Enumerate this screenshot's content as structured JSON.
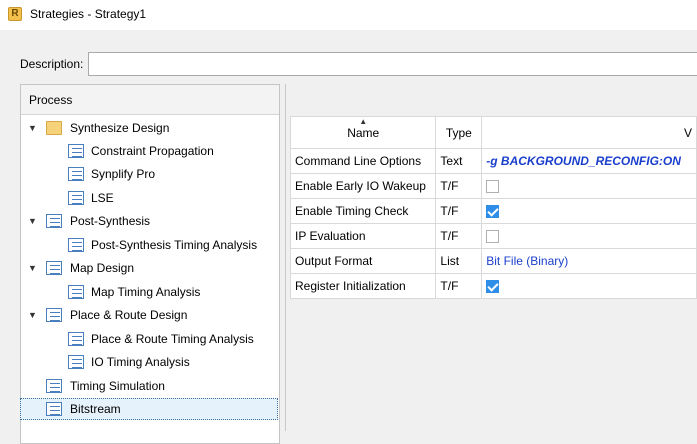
{
  "window": {
    "title": "Strategies - Strategy1",
    "icon": "app-logo-icon"
  },
  "description": {
    "label": "Description:",
    "value": ""
  },
  "process": {
    "header": "Process",
    "items": [
      {
        "label": "Synthesize Design",
        "icon": "folder-icon",
        "expandable": true
      },
      {
        "label": "Constraint Propagation",
        "icon": "document-icon"
      },
      {
        "label": "Synplify Pro",
        "icon": "document-icon"
      },
      {
        "label": "LSE",
        "icon": "document-icon"
      },
      {
        "label": "Post-Synthesis",
        "icon": "document-icon",
        "expandable": true
      },
      {
        "label": "Post-Synthesis Timing Analysis",
        "icon": "document-icon"
      },
      {
        "label": "Map Design",
        "icon": "document-icon",
        "expandable": true
      },
      {
        "label": "Map Timing Analysis",
        "icon": "document-icon"
      },
      {
        "label": "Place & Route Design",
        "icon": "document-icon",
        "expandable": true
      },
      {
        "label": "Place & Route Timing Analysis",
        "icon": "document-icon"
      },
      {
        "label": "IO Timing Analysis",
        "icon": "document-icon"
      },
      {
        "label": "Timing Simulation",
        "icon": "document-icon"
      },
      {
        "label": "Bitstream",
        "icon": "document-icon",
        "selected": true
      }
    ]
  },
  "table": {
    "columns": [
      "Name",
      "Type",
      "V"
    ],
    "rows": [
      {
        "name": "Command Line Options",
        "type": "Text",
        "value": "-g BACKGROUND_RECONFIG:ON"
      },
      {
        "name": "Enable Early IO Wakeup",
        "type": "T/F",
        "checked": false
      },
      {
        "name": "Enable Timing Check",
        "type": "T/F",
        "checked": true
      },
      {
        "name": "IP Evaluation",
        "type": "T/F",
        "checked": false
      },
      {
        "name": "Output Format",
        "type": "List",
        "value": "Bit File (Binary)"
      },
      {
        "name": "Register Initialization",
        "type": "T/F",
        "checked": true
      }
    ]
  },
  "colors": {
    "accent": "#2f8fe8",
    "link": "#1a3fcc",
    "selection": "#e5f1fb"
  }
}
